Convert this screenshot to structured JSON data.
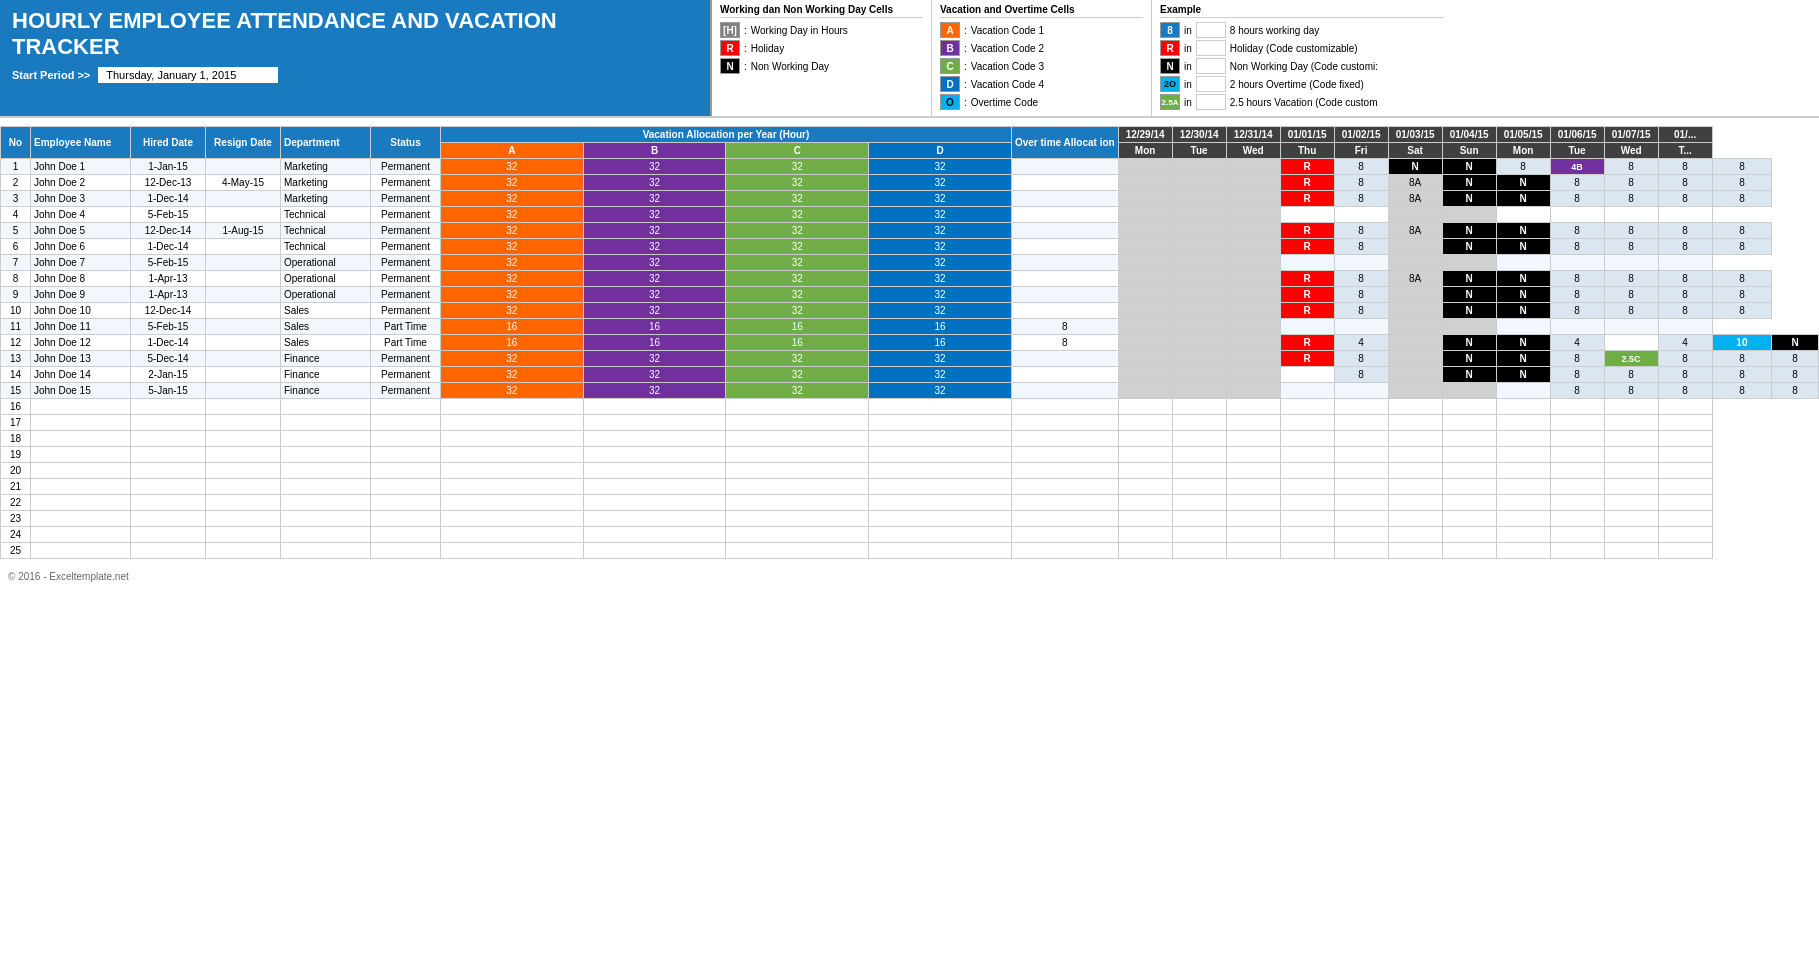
{
  "header": {
    "title_line1": "HOURLY EMPLOYEE ATTENDANCE AND VACATION",
    "title_line2": "TRACKER",
    "start_period_label": "Start Period >>",
    "start_period_value": "Thursday, January 1, 2015"
  },
  "legend_working": {
    "title": "Working dan Non Working Day Cells",
    "items": [
      {
        "code": "[H]",
        "color": "gray",
        "desc": "Working Day in Hours"
      },
      {
        "code": "R",
        "color": "red",
        "desc": "Holiday"
      },
      {
        "code": "N",
        "color": "black",
        "desc": "Non Working Day"
      }
    ]
  },
  "legend_vacation": {
    "title": "Vacation and Overtime Cells",
    "items": [
      {
        "code": "A",
        "color": "orange",
        "desc": "Vacation Code 1"
      },
      {
        "code": "B",
        "color": "blue-purple",
        "desc": "Vacation Code 2"
      },
      {
        "code": "C",
        "color": "green",
        "desc": "Vacation Code 3"
      },
      {
        "code": "D",
        "color": "dark-blue",
        "desc": "Vacation Code 4"
      },
      {
        "code": "O",
        "color": "teal",
        "desc": "Overtime Code"
      }
    ]
  },
  "legend_example": {
    "title": "Example",
    "items": [
      {
        "code": "8",
        "color_class": "blue-bg",
        "in": "in",
        "desc": "8 hours working day"
      },
      {
        "code": "R",
        "color_class": "red-bg",
        "in": "in",
        "desc": "Holiday (Code customizable)"
      },
      {
        "code": "N",
        "color_class": "black-bg",
        "in": "in",
        "desc": "Non Working Day (Code customi:"
      },
      {
        "code": "2O",
        "color_class": "teal-bg",
        "in": "in",
        "desc": "2 hours Overtime (Code fixed)"
      },
      {
        "code": "2.5A",
        "color_class": "green-bg",
        "in": "in",
        "desc": "2.5 hours Vacation (Code custom"
      }
    ]
  },
  "table": {
    "col_headers": [
      "No",
      "Employee Name",
      "Hired Date",
      "Resign Date",
      "Department",
      "Status"
    ],
    "vacation_header": "Vacation Allocation per Year (Hour)",
    "overtime_header": "Over time Allocat ion",
    "alloc_codes": [
      "A",
      "B",
      "C",
      "D"
    ],
    "dates": [
      {
        "date": "12/29/14",
        "day": "Mon"
      },
      {
        "date": "12/30/14",
        "day": "Tue"
      },
      {
        "date": "12/31/14",
        "day": "Wed"
      },
      {
        "date": "01/01/15",
        "day": "Thu"
      },
      {
        "date": "01/02/15",
        "day": "Fri"
      },
      {
        "date": "01/03/15",
        "day": "Sat"
      },
      {
        "date": "01/04/15",
        "day": "Sun"
      },
      {
        "date": "01/05/15",
        "day": "Mon"
      },
      {
        "date": "01/06/15",
        "day": "Tue"
      },
      {
        "date": "01/07/15",
        "day": "Wed"
      },
      {
        "date": "01/...",
        "day": "T..."
      }
    ],
    "employees": [
      {
        "no": 1,
        "name": "John Doe 1",
        "hired": "1-Jan-15",
        "resign": "",
        "dept": "Marketing",
        "status": "Permanent",
        "alloc": [
          32,
          32,
          32,
          32
        ],
        "overtime": "",
        "days": [
          "",
          "",
          "",
          "R",
          "8",
          "N",
          "N",
          "8",
          "4B",
          "8",
          "8",
          "8"
        ]
      },
      {
        "no": 2,
        "name": "John Doe 2",
        "hired": "12-Dec-13",
        "resign": "4-May-15",
        "dept": "Marketing",
        "status": "Permanent",
        "alloc": [
          32,
          32,
          32,
          32
        ],
        "overtime": "",
        "days": [
          "",
          "",
          "",
          "R",
          "8",
          "8A",
          "N",
          "N",
          "8",
          "8",
          "8",
          "8"
        ]
      },
      {
        "no": 3,
        "name": "John Doe 3",
        "hired": "1-Dec-14",
        "resign": "",
        "dept": "Marketing",
        "status": "Permanent",
        "alloc": [
          32,
          32,
          32,
          32
        ],
        "overtime": "",
        "days": [
          "",
          "",
          "",
          "R",
          "8",
          "8A",
          "N",
          "N",
          "8",
          "8",
          "8",
          "8"
        ]
      },
      {
        "no": 4,
        "name": "John Doe 4",
        "hired": "5-Feb-15",
        "resign": "",
        "dept": "Technical",
        "status": "Permanent",
        "alloc": [
          32,
          32,
          32,
          32
        ],
        "overtime": "",
        "days": [
          "",
          "",
          "",
          "",
          "",
          "",
          "",
          "",
          "",
          "",
          ""
        ]
      },
      {
        "no": 5,
        "name": "John Doe 5",
        "hired": "12-Dec-14",
        "resign": "1-Aug-15",
        "dept": "Technical",
        "status": "Permanent",
        "alloc": [
          32,
          32,
          32,
          32
        ],
        "overtime": "",
        "days": [
          "",
          "",
          "",
          "R",
          "8",
          "8A",
          "N",
          "N",
          "8",
          "8",
          "8",
          "8"
        ]
      },
      {
        "no": 6,
        "name": "John Doe 6",
        "hired": "1-Dec-14",
        "resign": "",
        "dept": "Technical",
        "status": "Permanent",
        "alloc": [
          32,
          32,
          32,
          32
        ],
        "overtime": "",
        "days": [
          "",
          "",
          "",
          "R",
          "8",
          "",
          "N",
          "N",
          "8",
          "8",
          "8",
          "8"
        ]
      },
      {
        "no": 7,
        "name": "John Doe 7",
        "hired": "5-Feb-15",
        "resign": "",
        "dept": "Operational",
        "status": "Permanent",
        "alloc": [
          32,
          32,
          32,
          32
        ],
        "overtime": "",
        "days": [
          "",
          "",
          "",
          "",
          "",
          "",
          "",
          "",
          "",
          "",
          ""
        ]
      },
      {
        "no": 8,
        "name": "John Doe 8",
        "hired": "1-Apr-13",
        "resign": "",
        "dept": "Operational",
        "status": "Permanent",
        "alloc": [
          32,
          32,
          32,
          32
        ],
        "overtime": "",
        "days": [
          "",
          "",
          "",
          "R",
          "8",
          "8A",
          "N",
          "N",
          "8",
          "8",
          "8",
          "8"
        ]
      },
      {
        "no": 9,
        "name": "John Doe 9",
        "hired": "1-Apr-13",
        "resign": "",
        "dept": "Operational",
        "status": "Permanent",
        "alloc": [
          32,
          32,
          32,
          32
        ],
        "overtime": "",
        "days": [
          "",
          "",
          "",
          "R",
          "8",
          "",
          "N",
          "N",
          "8",
          "8",
          "8",
          "8"
        ]
      },
      {
        "no": 10,
        "name": "John Doe 10",
        "hired": "12-Dec-14",
        "resign": "",
        "dept": "Sales",
        "status": "Permanent",
        "alloc": [
          32,
          32,
          32,
          32
        ],
        "overtime": "",
        "days": [
          "",
          "",
          "",
          "R",
          "8",
          "",
          "N",
          "N",
          "8",
          "8",
          "8",
          "8"
        ]
      },
      {
        "no": 11,
        "name": "John Doe 11",
        "hired": "5-Feb-15",
        "resign": "",
        "dept": "Sales",
        "status": "Part Time",
        "alloc": [
          16,
          16,
          16,
          16
        ],
        "overtime": "8",
        "days": [
          "",
          "",
          "",
          "",
          "",
          "",
          "",
          "",
          "",
          "",
          ""
        ]
      },
      {
        "no": 12,
        "name": "John Doe 12",
        "hired": "1-Dec-14",
        "resign": "",
        "dept": "Sales",
        "status": "Part Time",
        "alloc": [
          16,
          16,
          16,
          16
        ],
        "overtime": "8",
        "days": [
          "",
          "",
          "",
          "R",
          "4",
          "",
          "N",
          "N",
          "4",
          "",
          "4",
          "10",
          "N"
        ]
      },
      {
        "no": 13,
        "name": "John Doe 13",
        "hired": "5-Dec-14",
        "resign": "",
        "dept": "Finance",
        "status": "Permanent",
        "alloc": [
          32,
          32,
          32,
          32
        ],
        "overtime": "",
        "days": [
          "",
          "",
          "",
          "R",
          "8",
          "",
          "N",
          "N",
          "8",
          "2.5C",
          "8",
          "8",
          "8"
        ]
      },
      {
        "no": 14,
        "name": "John Doe 14",
        "hired": "2-Jan-15",
        "resign": "",
        "dept": "Finance",
        "status": "Permanent",
        "alloc": [
          32,
          32,
          32,
          32
        ],
        "overtime": "",
        "days": [
          "",
          "",
          "",
          "",
          "8",
          "",
          "N",
          "N",
          "8",
          "8",
          "8",
          "8",
          "8"
        ]
      },
      {
        "no": 15,
        "name": "John Doe 15",
        "hired": "5-Jan-15",
        "resign": "",
        "dept": "Finance",
        "status": "Permanent",
        "alloc": [
          32,
          32,
          32,
          32
        ],
        "overtime": "",
        "days": [
          "",
          "",
          "",
          "",
          "",
          "",
          "",
          "",
          "8",
          "8",
          "8",
          "8",
          "8"
        ]
      }
    ],
    "empty_rows": [
      16,
      17,
      18,
      19,
      20,
      21,
      22,
      23,
      24,
      25
    ]
  },
  "footer": {
    "text": "© 2016 - Exceltemplate.net"
  }
}
